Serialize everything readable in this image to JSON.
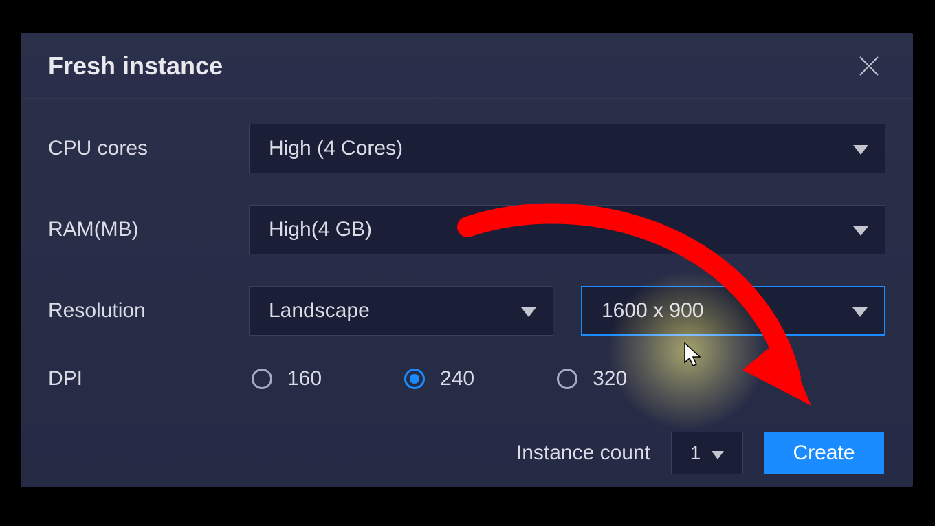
{
  "dialog": {
    "title": "Fresh instance"
  },
  "cpu": {
    "label": "CPU cores",
    "value": "High (4 Cores)"
  },
  "ram": {
    "label": "RAM(MB)",
    "value": "High(4 GB)"
  },
  "resolution": {
    "label": "Resolution",
    "orientation": "Landscape",
    "size": "1600 x 900"
  },
  "dpi": {
    "label": "DPI",
    "options": [
      "160",
      "240",
      "320"
    ],
    "selected": "240"
  },
  "footer": {
    "count_label": "Instance count",
    "count_value": "1",
    "create_label": "Create"
  }
}
